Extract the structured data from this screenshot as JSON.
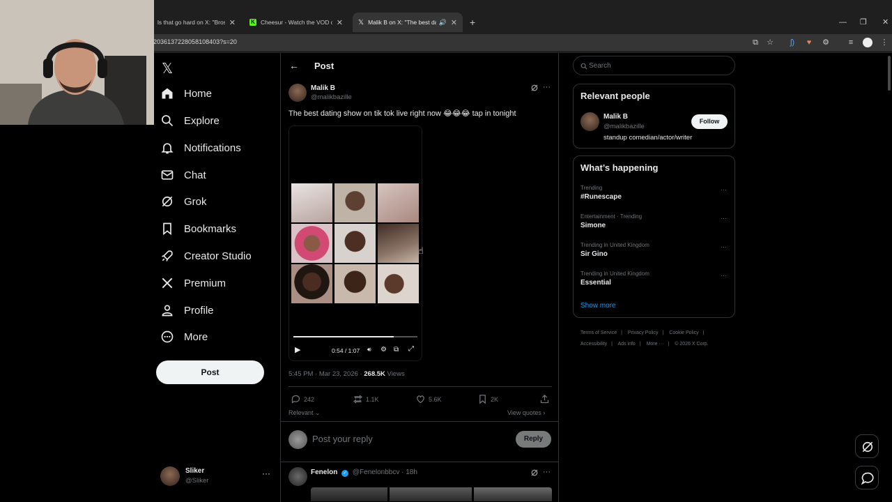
{
  "browser": {
    "tabs": [
      {
        "title": "ls that go hard on X: \"Bros be",
        "favicon": "x-logo"
      },
      {
        "title": "Cheesur - Watch the VOD on K",
        "favicon": "kick-logo"
      },
      {
        "title": "Malik B on X: \"The best dati",
        "favicon": "x-logo"
      }
    ],
    "url": "2036137228058108403?s=20"
  },
  "nav": {
    "items": [
      {
        "label": "Home",
        "icon": "home-icon"
      },
      {
        "label": "Explore",
        "icon": "search-icon"
      },
      {
        "label": "Notifications",
        "icon": "bell-icon"
      },
      {
        "label": "Chat",
        "icon": "mail-icon"
      },
      {
        "label": "Grok",
        "icon": "grok-icon"
      },
      {
        "label": "Bookmarks",
        "icon": "bookmark-icon"
      },
      {
        "label": "Creator Studio",
        "icon": "rocket-icon"
      },
      {
        "label": "Premium",
        "icon": "x-logo-icon"
      },
      {
        "label": "Profile",
        "icon": "person-icon"
      },
      {
        "label": "More",
        "icon": "more-circle-icon"
      }
    ],
    "post_label": "Post",
    "account": {
      "name": "Sliker",
      "handle": "@Sliker"
    }
  },
  "main": {
    "header": "Post",
    "tweet": {
      "author_name": "Malik B",
      "author_handle": "@malikbazille",
      "text": "The best dating show on tik tok live right now 😂😂😂 tap in tonight",
      "video": {
        "time": "0:54 / 1:07",
        "progress": 0.81
      },
      "timestamp": "5:45 PM · Mar 23, 2026 · ",
      "views_count": "268.5K",
      "views_label": " Views",
      "replies": "242",
      "reposts": "1.1K",
      "likes": "5.6K",
      "bookmarks": "2K"
    },
    "sort_label": "Relevant",
    "view_quotes": "View quotes",
    "reply_placeholder": "Post your reply",
    "reply_button": "Reply",
    "reply": {
      "name": "Fenelon",
      "handle": "@Fenelonbbcv",
      "time": "· 18h"
    }
  },
  "sidebar": {
    "search_placeholder": "Search",
    "relevant_title": "Relevant people",
    "person": {
      "name": "Malik B",
      "handle": "@malikbazille",
      "bio": "standup comedian/actor/writer",
      "follow_label": "Follow"
    },
    "happening_title": "What’s happening",
    "trends": [
      {
        "category": "Trending",
        "name": "#Runescape"
      },
      {
        "category": "Entertainment · Trending",
        "name": "Simone"
      },
      {
        "category": "Trending in United Kingdom",
        "name": "Sir Gino"
      },
      {
        "category": "Trending in United Kingdom",
        "name": "Essential"
      }
    ],
    "show_more": "Show more",
    "footer": {
      "terms": "Terms of Service",
      "privacy": "Privacy Policy",
      "cookie": "Cookie Policy",
      "accessibility": "Accessibility",
      "ads": "Ads info",
      "more": "More ···",
      "copyright": "© 2026 X Corp."
    }
  },
  "colors": {
    "accent": "#1d9bf0",
    "background": "#000000",
    "border": "#2f3336",
    "muted": "#71767b"
  }
}
